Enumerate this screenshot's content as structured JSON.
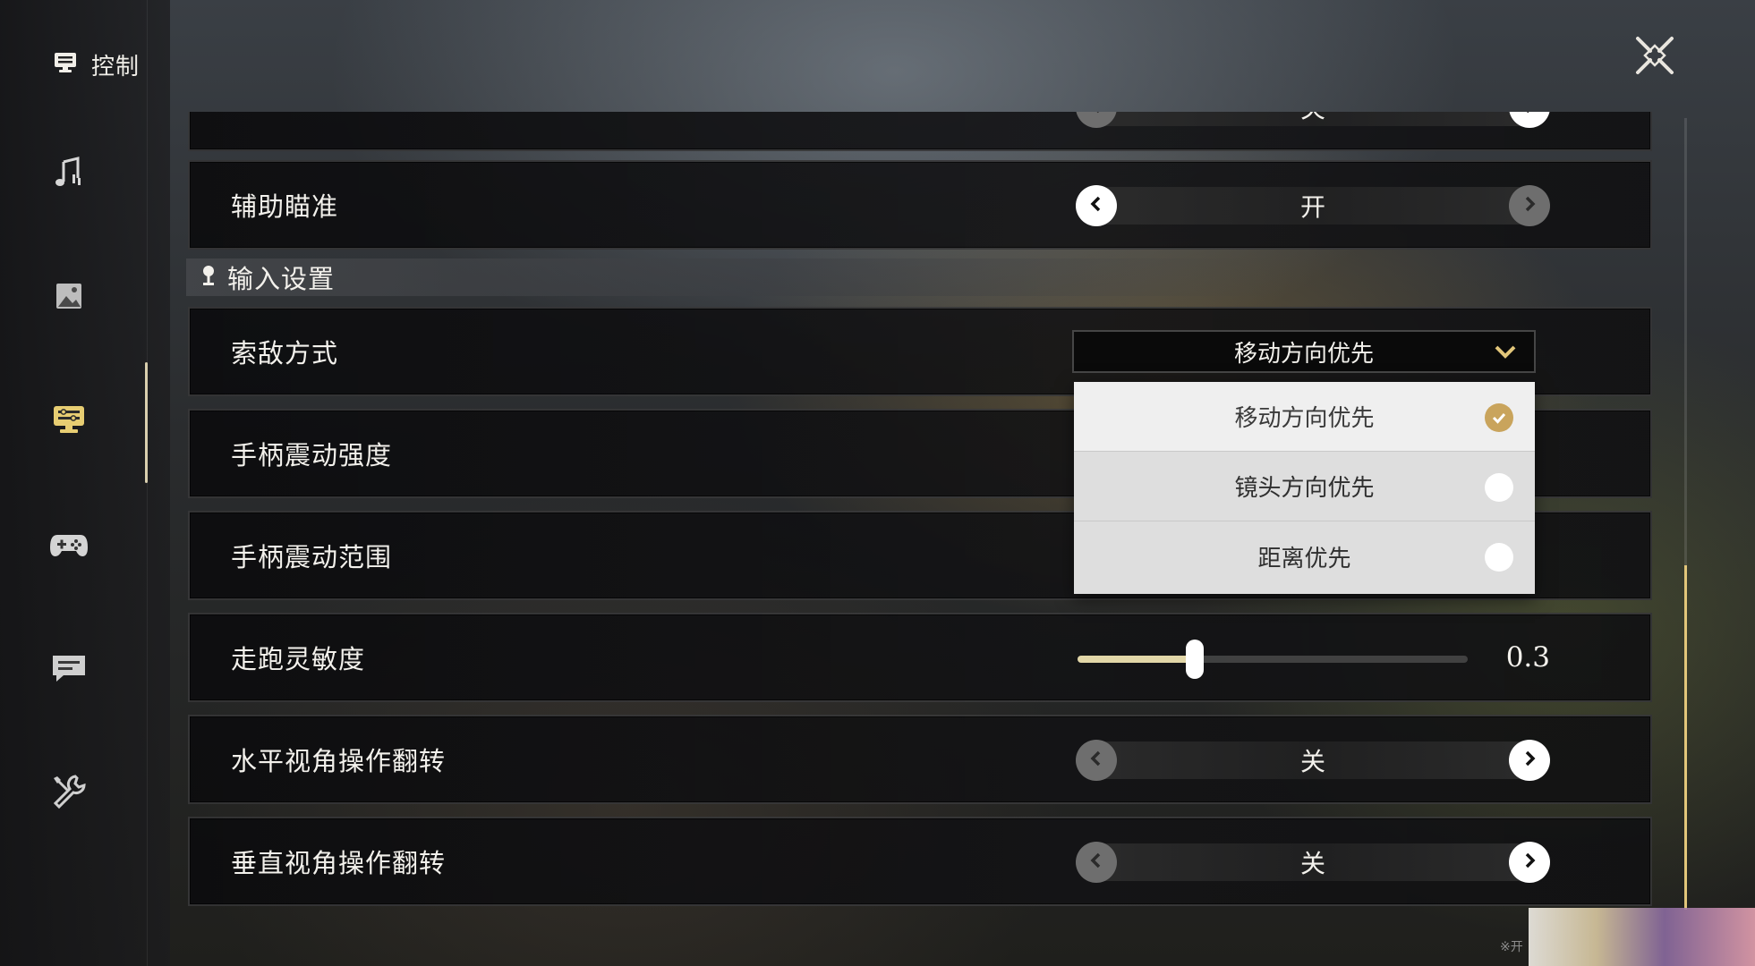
{
  "header": {
    "title": "控制",
    "icon": "control-settings-icon"
  },
  "sidebar": {
    "items": [
      {
        "name": "audio",
        "icon": "music-note-icon",
        "active": false
      },
      {
        "name": "graphics",
        "icon": "image-icon",
        "active": false
      },
      {
        "name": "control",
        "icon": "control-settings-icon",
        "active": true
      },
      {
        "name": "gamepad",
        "icon": "gamepad-icon",
        "active": false
      },
      {
        "name": "language",
        "icon": "chat-bubble-icon",
        "active": false
      },
      {
        "name": "other",
        "icon": "tools-icon",
        "active": false
      }
    ]
  },
  "settings": {
    "partial_row": {
      "value": "关"
    },
    "aim_assist": {
      "label": "辅助瞄准",
      "value": "开"
    },
    "section_input": {
      "title": "输入设置"
    },
    "target_mode": {
      "label": "索敌方式",
      "selected": "移动方向优先",
      "options": [
        {
          "label": "移动方向优先",
          "checked": true
        },
        {
          "label": "镜头方向优先",
          "checked": false
        },
        {
          "label": "距离优先",
          "checked": false
        }
      ]
    },
    "vibration_strength": {
      "label": "手柄震动强度"
    },
    "vibration_range": {
      "label": "手柄震动范围"
    },
    "run_sensitivity": {
      "label": "走跑灵敏度",
      "value": "0.3",
      "fraction": 0.3
    },
    "invert_horizontal": {
      "label": "水平视角操作翻转",
      "value": "关"
    },
    "invert_vertical": {
      "label": "垂直视角操作翻转",
      "value": "关"
    }
  },
  "footer": {
    "note": "※开"
  },
  "colors": {
    "accent": "#e2c67a",
    "check": "#c9a45c",
    "slider_fill": "#e2d7a8"
  }
}
